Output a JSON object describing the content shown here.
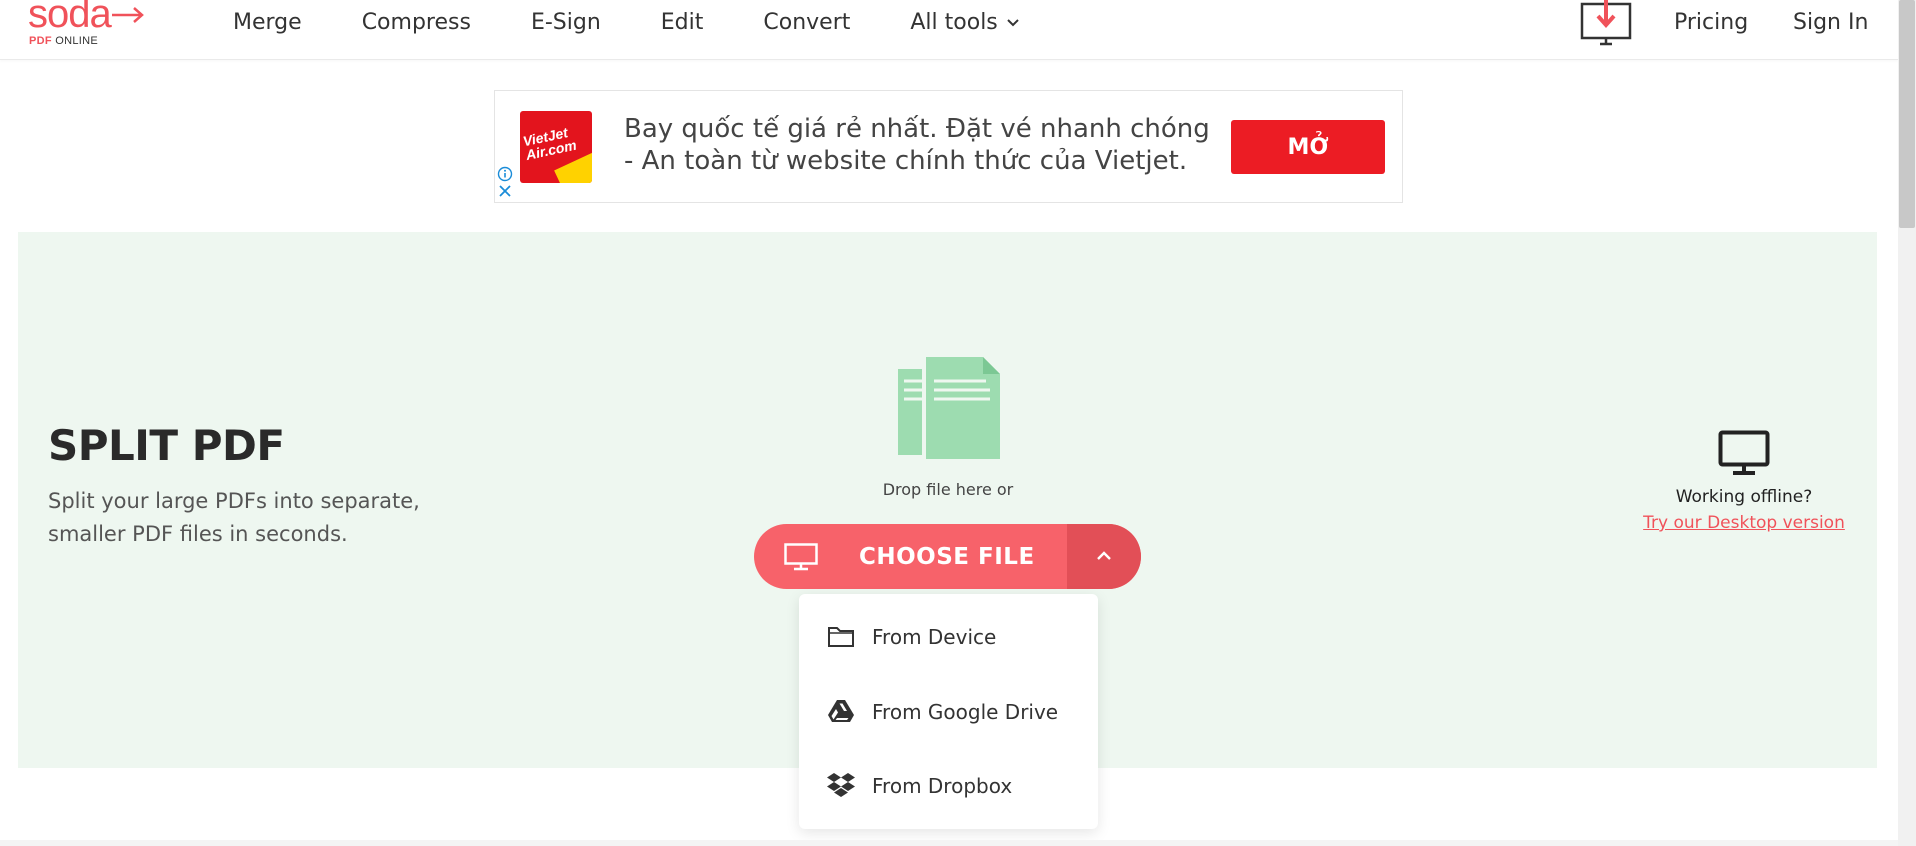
{
  "brand": {
    "logo_word": "soda",
    "logo_sub_pdf": "PDF",
    "logo_sub_online": "ONLINE",
    "accent_color": "#f0525a"
  },
  "nav": {
    "items": [
      "Merge",
      "Compress",
      "E-Sign",
      "Edit",
      "Convert",
      "All tools"
    ],
    "pricing": "Pricing",
    "sign_in": "Sign In"
  },
  "ad": {
    "logo_text_1": "VietJet",
    "logo_text_2": "Air.com",
    "text": "Bay quốc tế giá rẻ nhất. Đặt vé nhanh chóng - An toàn từ website chính thức của Vietjet.",
    "button_label": "MỞ",
    "button_color": "#ec1c24"
  },
  "hero": {
    "title": "SPLIT PDF",
    "description": "Split your large PDFs into separate, smaller PDF files in seconds.",
    "drop_text": "Drop file here or",
    "choose_file_label": "CHOOSE FILE",
    "background_color": "#eef7f0"
  },
  "upload_menu": {
    "items": [
      "From Device",
      "From Google Drive",
      "From Dropbox"
    ]
  },
  "offline": {
    "text": "Working offline?",
    "link": "Try our Desktop version"
  }
}
